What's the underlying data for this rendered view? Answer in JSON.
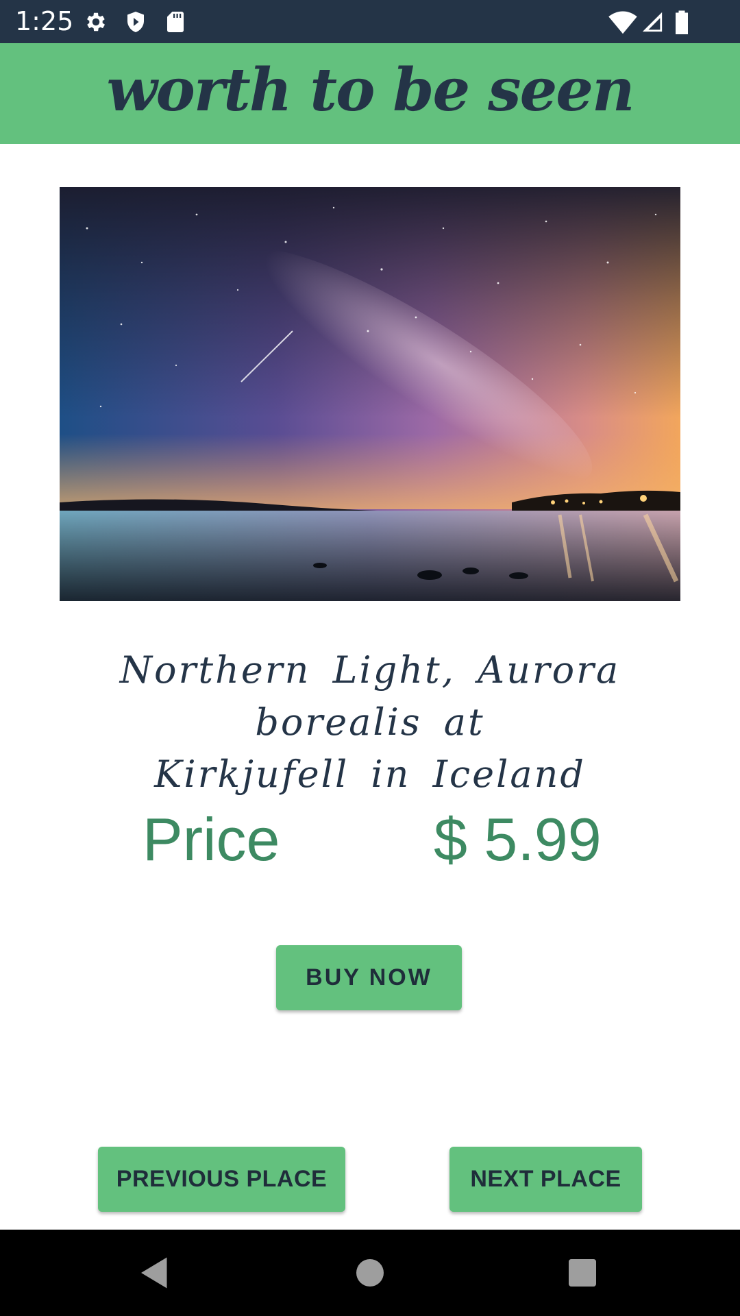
{
  "status_bar": {
    "time": "1:25",
    "icons": [
      "gear-icon",
      "shield-play-icon",
      "sd-card-icon",
      "wifi-icon",
      "signal-icon",
      "battery-icon"
    ]
  },
  "header": {
    "title": "worth to be seen"
  },
  "hero": {
    "image_description_icon": "night-sky-photo"
  },
  "place": {
    "caption_line1": "Northern Light, Aurora borealis at",
    "caption_line2": "Kirkjufell in Iceland",
    "price_label": "Price",
    "price_value": "$ 5.99"
  },
  "actions": {
    "buy_label": "BUY NOW",
    "previous_label": "PREVIOUS PLACE",
    "next_label": "NEXT PLACE"
  },
  "nav": {
    "buttons": [
      "back-icon",
      "home-icon",
      "recents-icon"
    ]
  },
  "colors": {
    "status_bar": "#243447",
    "header": "#63c17e",
    "title_text": "#243447",
    "price_text": "#3d8a62",
    "button": "#63c17e",
    "nav_bar": "#000000"
  }
}
